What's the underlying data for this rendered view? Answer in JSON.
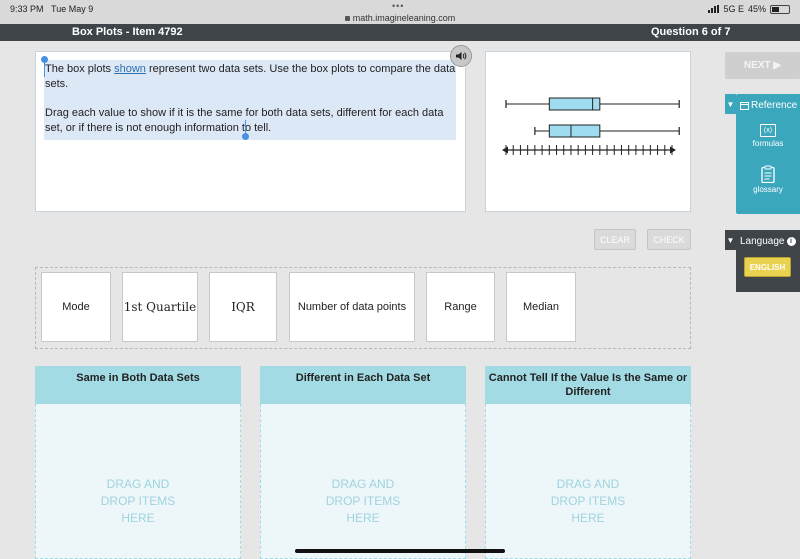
{
  "status_bar": {
    "time": "9:33 PM",
    "date": "Tue May 9",
    "url": "math.imagineleaning.com",
    "network": "5G E",
    "battery": "45%"
  },
  "header": {
    "title": "Box Plots - Item 4792",
    "question": "Question 6 of 7"
  },
  "prompt": {
    "p1_before": "The box plots ",
    "p1_link": "shown",
    "p1_after": " represent two data sets. Use the box plots to compare the data sets.",
    "p2": "Drag each value to show if it is the same for both data sets, different for each data set, or if there is not enough information to tell."
  },
  "chart_data": {
    "type": "box",
    "title": "",
    "xlabel": "",
    "ylabel": "",
    "tick_labels_shown": false,
    "axis_ticks": 24,
    "series": [
      {
        "min": 1,
        "q1": 7,
        "median": 13,
        "q3": 14,
        "max": 25
      },
      {
        "min": 5,
        "q1": 7,
        "median": 10,
        "q3": 14,
        "max": 25
      }
    ]
  },
  "controls": {
    "next_label": "NEXT",
    "clear_label": "CLEAR",
    "check_label": "CHECK"
  },
  "reference": {
    "label": "Reference",
    "formulas_label": "formulas",
    "formulas_icon_text": "(x)",
    "glossary_label": "glossary"
  },
  "language": {
    "label": "Language",
    "english_label": "ENGLISH"
  },
  "bank": {
    "items": [
      "Mode",
      "1st Quartile",
      "IQR",
      "Number of data points",
      "Range",
      "Median"
    ]
  },
  "zones": [
    {
      "title": "Same in Both Data Sets",
      "hint": "DRAG AND\nDROP ITEMS\nHERE"
    },
    {
      "title": "Different in Each Data Set",
      "hint": "DRAG AND\nDROP ITEMS\nHERE"
    },
    {
      "title": "Cannot Tell If the Value Is the Same or Different",
      "hint": "DRAG AND\nDROP ITEMS\nHERE"
    }
  ],
  "colors": {
    "accent": "#3aa7bd",
    "zone_header": "#a3dbe4",
    "box_fill": "#9fdcef",
    "dark_bar": "#3f4448"
  }
}
